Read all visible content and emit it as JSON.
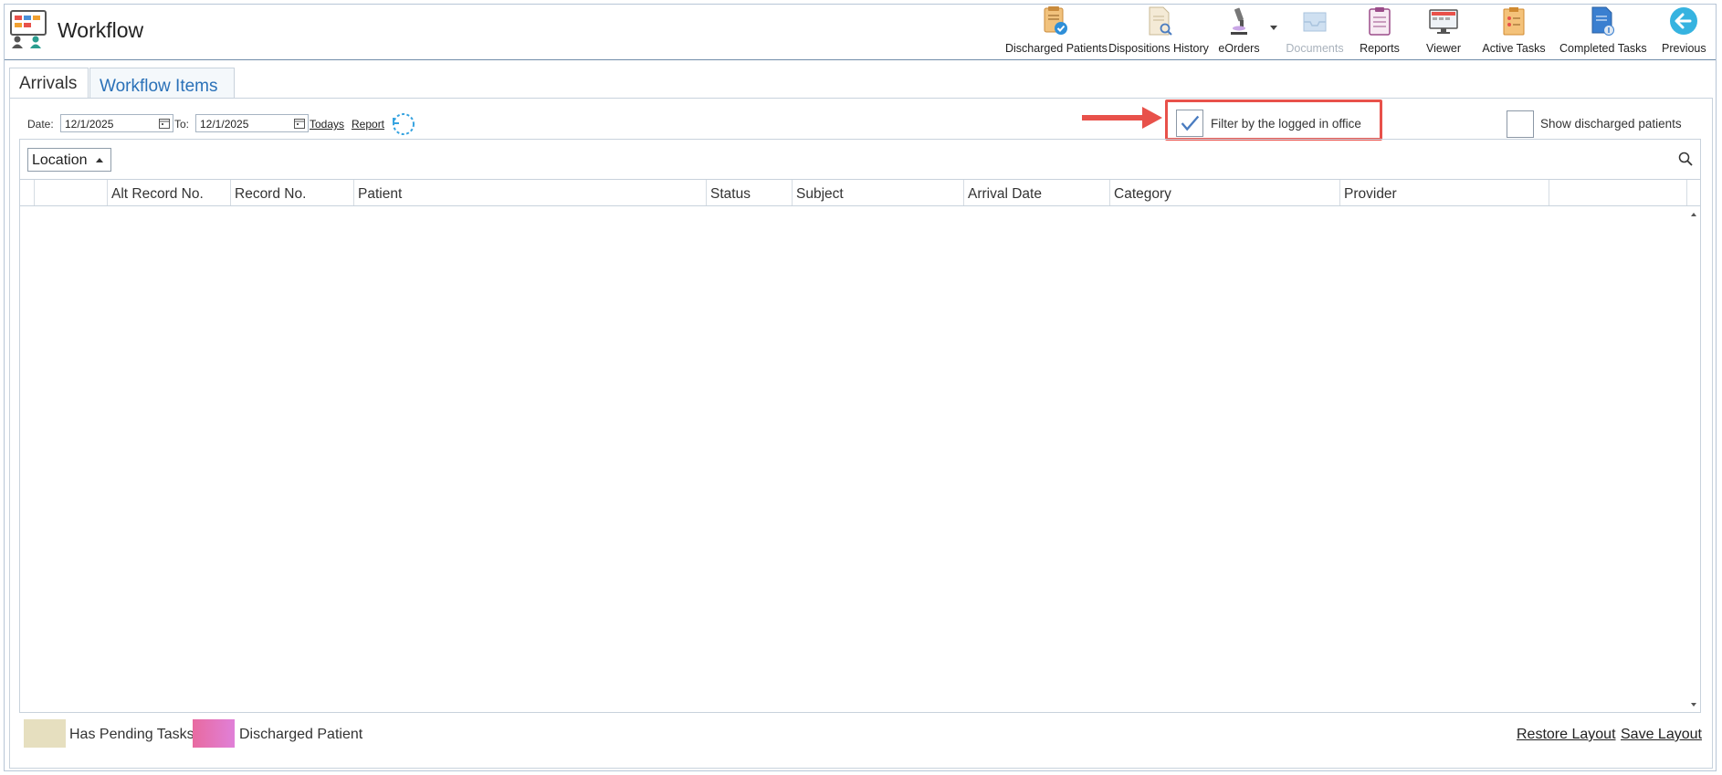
{
  "app": {
    "title": "Workflow"
  },
  "toolbar": {
    "items": [
      {
        "label": "Discharged Patients",
        "icon": "discharged-patients-icon"
      },
      {
        "label": "Dispositions History",
        "icon": "dispositions-history-icon"
      },
      {
        "label": "eOrders",
        "icon": "microscope-icon"
      },
      {
        "label": "Documents",
        "icon": "documents-tray-icon",
        "disabled": true
      },
      {
        "label": "Reports",
        "icon": "clipboard-icon"
      },
      {
        "label": "Viewer",
        "icon": "monitor-icon"
      },
      {
        "label": "Active Tasks",
        "icon": "active-tasks-icon"
      },
      {
        "label": "Completed Tasks",
        "icon": "completed-tasks-icon"
      },
      {
        "label": "Previous",
        "icon": "back-arrow-icon"
      }
    ]
  },
  "tabs": [
    {
      "label": "Arrivals"
    },
    {
      "label": "Workflow Items"
    }
  ],
  "filters": {
    "date_label": "Date:",
    "date_from": "12/1/2025",
    "to_label": "To:",
    "date_to": "12/1/2025",
    "todays_link": "Todays",
    "report_link": "Report",
    "filter_office_label": "Filter by the logged in office",
    "filter_office_checked": true,
    "show_discharged_label": "Show discharged patients",
    "show_discharged_checked": false
  },
  "grouping": {
    "location_label": "Location"
  },
  "grid": {
    "columns": [
      "Alt Record No.",
      "Record No.",
      "Patient",
      "Status",
      "Subject",
      "Arrival Date",
      "Category",
      "Provider"
    ],
    "rows": []
  },
  "legend": [
    {
      "label": "Has Pending Tasks",
      "color": "#e6dfbf"
    },
    {
      "label": "Discharged Patient",
      "color": "#e06aa8"
    }
  ],
  "footer": {
    "restore_layout": "Restore Layout",
    "save_layout": "Save Layout"
  },
  "colors": {
    "accent": "#2a71b8",
    "annotation": "#e8514a",
    "check": "#4a7cc0"
  }
}
